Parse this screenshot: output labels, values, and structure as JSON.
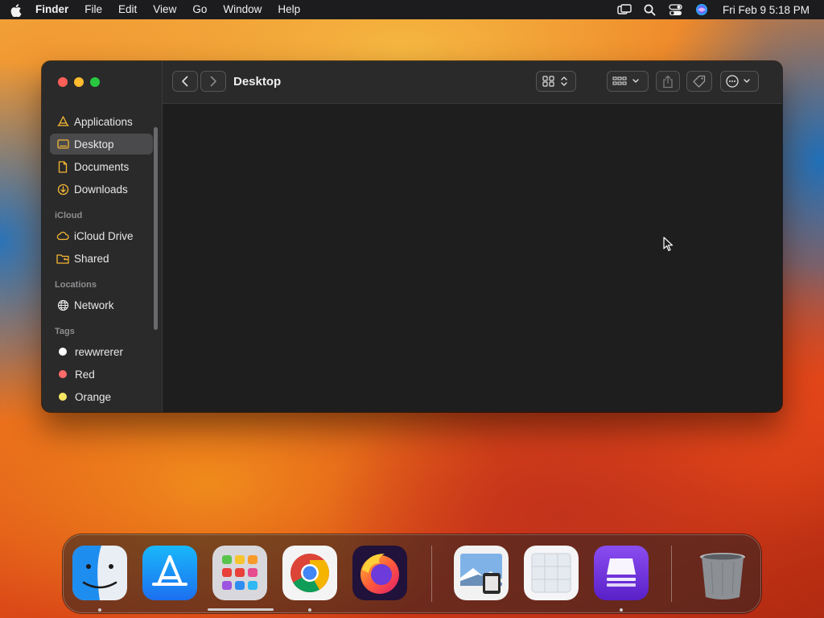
{
  "menubar": {
    "app_name": "Finder",
    "menus": [
      "File",
      "Edit",
      "View",
      "Go",
      "Window",
      "Help"
    ],
    "clock": "Fri Feb 9  5:18 PM"
  },
  "finder": {
    "title": "Desktop",
    "favorites": [
      {
        "label": "Applications",
        "icon": "applications-icon"
      },
      {
        "label": "Desktop",
        "icon": "desktop-icon",
        "selected": true
      },
      {
        "label": "Documents",
        "icon": "documents-icon"
      },
      {
        "label": "Downloads",
        "icon": "downloads-icon"
      }
    ],
    "icloud_header": "iCloud",
    "icloud": [
      {
        "label": "iCloud Drive",
        "icon": "cloud-icon"
      },
      {
        "label": "Shared",
        "icon": "shared-folder-icon"
      }
    ],
    "locations_header": "Locations",
    "locations": [
      {
        "label": "Network",
        "icon": "globe-icon"
      }
    ],
    "tags_header": "Tags",
    "tags": [
      {
        "label": "rewwrerer",
        "color": "#ffffff"
      },
      {
        "label": "Red",
        "color": "#ff6b6b"
      },
      {
        "label": "Orange",
        "color": "#f5e663"
      }
    ]
  },
  "dock": {
    "apps": [
      "Finder",
      "App Store",
      "Launchpad",
      "Google Chrome",
      "Firefox",
      "Preview",
      "Screenshot",
      "Simulator",
      "Trash"
    ]
  },
  "colors": {
    "accent": "#f5b834",
    "window_bg": "#1e1e1e",
    "sidebar_bg": "#2a2a2b"
  }
}
